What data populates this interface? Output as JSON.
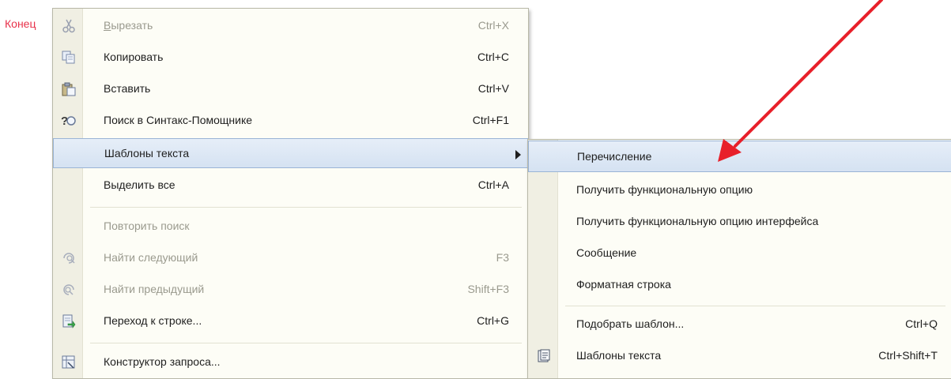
{
  "background_text": "Конец",
  "main_menu": {
    "items": [
      {
        "label": "Вырезать",
        "shortcut": "Ctrl+X",
        "icon": "scissors-icon",
        "disabled": true
      },
      {
        "label": "Копировать",
        "shortcut": "Ctrl+C",
        "icon": "copy-icon",
        "disabled": false
      },
      {
        "label": "Вставить",
        "shortcut": "Ctrl+V",
        "icon": "paste-icon",
        "disabled": false
      },
      {
        "label": "Поиск в Синтакс-Помощнике",
        "shortcut": "Ctrl+F1",
        "icon": "syntax-help-icon",
        "disabled": false
      },
      {
        "label": "Шаблоны текста",
        "shortcut": "",
        "icon": "",
        "disabled": false,
        "submenu": true,
        "highlighted": true
      },
      {
        "label": "Выделить все",
        "shortcut": "Ctrl+A",
        "icon": "",
        "disabled": false
      },
      {
        "label": "Повторить поиск",
        "shortcut": "",
        "icon": "",
        "disabled": true
      },
      {
        "label": "Найти следующий",
        "shortcut": "F3",
        "icon": "find-next-icon",
        "disabled": true
      },
      {
        "label": "Найти предыдущий",
        "shortcut": "Shift+F3",
        "icon": "find-previous-icon",
        "disabled": true
      },
      {
        "label": "Переход к строке...",
        "shortcut": "Ctrl+G",
        "icon": "goto-line-icon",
        "disabled": false
      },
      {
        "label": "Конструктор запроса...",
        "shortcut": "",
        "icon": "query-builder-icon",
        "disabled": false
      }
    ]
  },
  "sub_menu": {
    "items": [
      {
        "label": "Перечисление",
        "shortcut": "",
        "highlighted": true
      },
      {
        "label": "Получить функциональную опцию",
        "shortcut": ""
      },
      {
        "label": "Получить функциональную опцию интерфейса",
        "shortcut": ""
      },
      {
        "label": "Сообщение",
        "shortcut": ""
      },
      {
        "label": "Форматная строка",
        "shortcut": ""
      },
      {
        "label": "Подобрать шаблон...",
        "shortcut": "Ctrl+Q"
      },
      {
        "label": "Шаблоны текста",
        "shortcut": "Ctrl+Shift+T",
        "icon": "templates-icon"
      }
    ]
  },
  "colors": {
    "annotation_arrow": "#e8202a",
    "highlight": "#dce7f5",
    "background_text": "#e8314a"
  }
}
